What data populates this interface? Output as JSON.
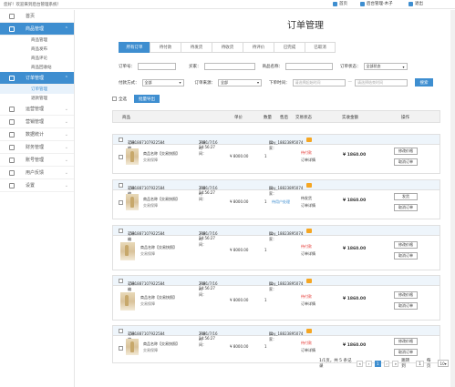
{
  "topbar": {
    "welcome": "您好！欢迎来到后台管理系统！",
    "home": "首页",
    "user": "后台管理-木子",
    "logout": "退出"
  },
  "sidebar": {
    "items": [
      {
        "label": "首页",
        "icon": "home-icon",
        "active": false
      },
      {
        "label": "商品管理",
        "icon": "goods-icon",
        "active": true
      },
      {
        "label": "订单管理",
        "icon": "order-icon",
        "active": true
      },
      {
        "label": "运营管理",
        "icon": "operation-icon",
        "active": false
      },
      {
        "label": "营销管理",
        "icon": "marketing-icon",
        "active": false
      },
      {
        "label": "数据统计",
        "icon": "stats-icon",
        "active": false
      },
      {
        "label": "财务管理",
        "icon": "finance-icon",
        "active": false
      },
      {
        "label": "账号管理",
        "icon": "account-icon",
        "active": false
      },
      {
        "label": "用户反馈",
        "icon": "feedback-icon",
        "active": false
      },
      {
        "label": "设置",
        "icon": "settings-icon",
        "active": false
      }
    ],
    "goods_sub": [
      "商品管理",
      "商品发布",
      "商品评论",
      "商品回收站"
    ],
    "order_sub": [
      "订单管理",
      "退款管理"
    ]
  },
  "page": {
    "title": "订单管理",
    "tabs": [
      "所有订单",
      "待付款",
      "待发货",
      "待收货",
      "待评价",
      "已完成",
      "已取消"
    ]
  },
  "filters": {
    "order_no_label": "订单号：",
    "buyer_label": "买家：",
    "product_name_label": "商品名称：",
    "order_status_label": "订单状态：",
    "order_status_value": "全部状态",
    "pay_type_label": "付款方式：",
    "pay_type_value": "全部",
    "source_label": "订单来源：",
    "source_value": "全部",
    "time_label": "下单时间：",
    "start_placeholder": "请选择起始时间",
    "end_placeholder": "请选择结束时间",
    "dash": "—",
    "search": "搜索",
    "select_all": "全选",
    "export": "批量导出"
  },
  "table": {
    "headers": [
      "商品",
      "单价",
      "数量",
      "售后",
      "交易状态",
      "实收金额",
      "操作"
    ],
    "orders": [
      {
        "no_label": "订单编号：",
        "no": "1531887107922584",
        "time_label": "下单时间：",
        "time": "2021/7/16 14:56:27",
        "buyer_label": "买家：",
        "buyer": "hby_18823895074",
        "product": "商品名称【交易快照】",
        "refund": "交易保障",
        "price": "¥ 8000.00",
        "qty": "1",
        "aftersale": "",
        "status": "待付款",
        "status_sub": "订单详情",
        "amount": "¥ 1860.00",
        "btn1": "修改价格",
        "btn2": "取消订单"
      },
      {
        "no_label": "订单编号：",
        "no": "1531887107922584",
        "time_label": "下单时间：",
        "time": "2021/7/16 14:56:27",
        "buyer_label": "买家：",
        "buyer": "hby_18823895074",
        "product": "商品名称【交易快照】",
        "refund": "交易保障",
        "price": "¥ 8000.00",
        "qty": "1",
        "aftersale": "待用户处理",
        "status": "待发货",
        "status_sub": "订单详情",
        "amount": "¥ 1860.00",
        "btn1": "发货",
        "btn2": "取消订单"
      },
      {
        "no_label": "订单编号：",
        "no": "1531887107922584",
        "time_label": "下单时间：",
        "time": "2021/7/16 14:56:27",
        "buyer_label": "买家：",
        "buyer": "hby_18823895074",
        "product": "商品名称【交易快照】",
        "refund": "交易保障",
        "price": "¥ 8000.00",
        "qty": "1",
        "aftersale": "",
        "status": "待付款",
        "status_sub": "订单详情",
        "amount": "¥ 1860.00",
        "btn1": "修改价格",
        "btn2": "取消订单"
      },
      {
        "no_label": "订单编号：",
        "no": "1531887107922584",
        "time_label": "下单时间：",
        "time": "2021/7/16 14:56:27",
        "buyer_label": "买家：",
        "buyer": "hby_18823895074",
        "product": "商品名称【交易快照】",
        "refund": "交易保障",
        "price": "¥ 8000.00",
        "qty": "1",
        "aftersale": "",
        "status": "待付款",
        "status_sub": "订单详情",
        "amount": "¥ 1860.00",
        "btn1": "修改价格",
        "btn2": "取消订单"
      },
      {
        "no_label": "订单编号：",
        "no": "1531887107922584",
        "time_label": "下单时间：",
        "time": "2021/7/16 14:56:27",
        "buyer_label": "买家：",
        "buyer": "hby_18823895074",
        "product": "商品名称【交易快照】",
        "refund": "交易保障",
        "price": "¥ 8000.00",
        "qty": "1",
        "aftersale": "",
        "status": "待付款",
        "status_sub": "订单详情",
        "amount": "¥ 1860.00",
        "btn1": "修改价格",
        "btn2": "取消订单"
      }
    ]
  },
  "pager": {
    "info": "1/1页，共 5 条记录",
    "first": "«",
    "prev": "‹",
    "current": "1",
    "next": "›",
    "last": "»",
    "jump_label": "跳转到",
    "jump_value": "1",
    "per_page_label": "每页",
    "per_page_value": "10",
    "per_page_unit": "条"
  },
  "colors": {
    "accent": "#3e8ed0",
    "danger": "#e53935",
    "warning": "#f5a623"
  }
}
